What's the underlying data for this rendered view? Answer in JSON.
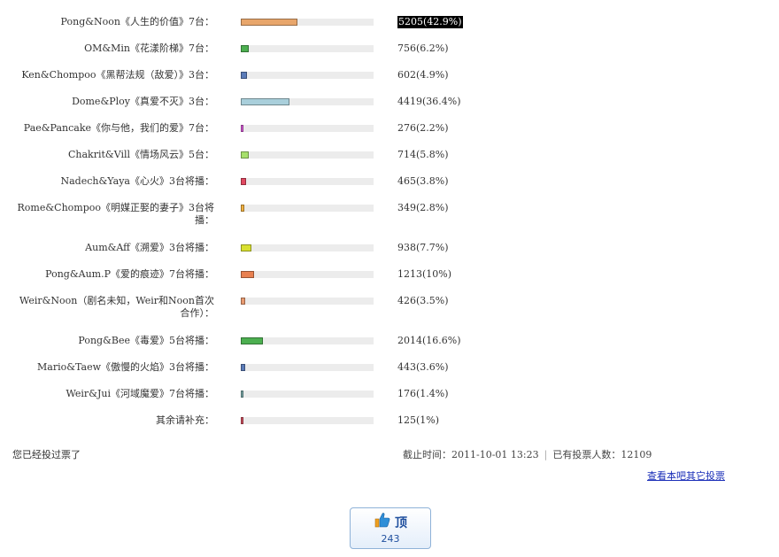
{
  "poll": {
    "items": [
      {
        "label": "Pong&Noon《人生的价值》7台：",
        "value_text": "5205(42.9%)",
        "percent": 42.9,
        "color": "#e8a66b",
        "highlight": true
      },
      {
        "label": "OM&Min《花漾阶梯》7台：",
        "value_text": "756(6.2%)",
        "percent": 6.2,
        "color": "#4caf50"
      },
      {
        "label": "Ken&Chompoo《黑帮法规（敌爱）》3台：",
        "value_text": "602(4.9%)",
        "percent": 4.9,
        "color": "#5b7bb8"
      },
      {
        "label": "Dome&Ploy《真爱不灭》3台：",
        "value_text": "4419(36.4%)",
        "percent": 36.4,
        "color": "#a9cfdb"
      },
      {
        "label": "Pae&Pancake《你与他，我们的爱》7台：",
        "value_text": "276(2.2%)",
        "percent": 2.2,
        "color": "#d65bd6"
      },
      {
        "label": "Chakrit&Vill《情场风云》5台：",
        "value_text": "714(5.8%)",
        "percent": 5.8,
        "color": "#a6e06b"
      },
      {
        "label": "Nadech&Yaya《心火》3台将播：",
        "value_text": "465(3.8%)",
        "percent": 3.8,
        "color": "#e04860"
      },
      {
        "label": "Rome&Chompoo《明媒正娶的妻子》3台将播：",
        "value_text": "349(2.8%)",
        "percent": 2.8,
        "color": "#f0b040"
      },
      {
        "label": "Aum&Aff《溯爱》3台将播：",
        "value_text": "938(7.7%)",
        "percent": 7.7,
        "color": "#d9e030"
      },
      {
        "label": "Pong&Aum.P《爱的痕迹》7台将播：",
        "value_text": "1213(10%)",
        "percent": 10,
        "color": "#e88050"
      },
      {
        "label": "Weir&Noon（剧名未知，Weir和Noon首次合作）：",
        "value_text": "426(3.5%)",
        "percent": 3.5,
        "color": "#e89a70"
      },
      {
        "label": "Pong&Bee《毒爱》5台将播：",
        "value_text": "2014(16.6%)",
        "percent": 16.6,
        "color": "#4caf50"
      },
      {
        "label": "Mario&Taew《傲慢的火焰》3台将播：",
        "value_text": "443(3.6%)",
        "percent": 3.6,
        "color": "#5b7bb8"
      },
      {
        "label": "Weir&Jui《河域魔爱》7台将播：",
        "value_text": "176(1.4%)",
        "percent": 1.4,
        "color": "#7aa8a8"
      },
      {
        "label": "其余请补充：",
        "value_text": "125(1%)",
        "percent": 1,
        "color": "#d05060"
      }
    ]
  },
  "footer": {
    "voted_text": "您已经投过票了",
    "deadline_label": "截止时间：",
    "deadline_value": "2011-10-01 13:23",
    "separator": "|",
    "voters_label": "已有投票人数：",
    "voters_value": "12109",
    "other_link": "查看本吧其它投票"
  },
  "ding": {
    "label": "顶",
    "count": "243",
    "icon": "thumbs-up-icon"
  }
}
